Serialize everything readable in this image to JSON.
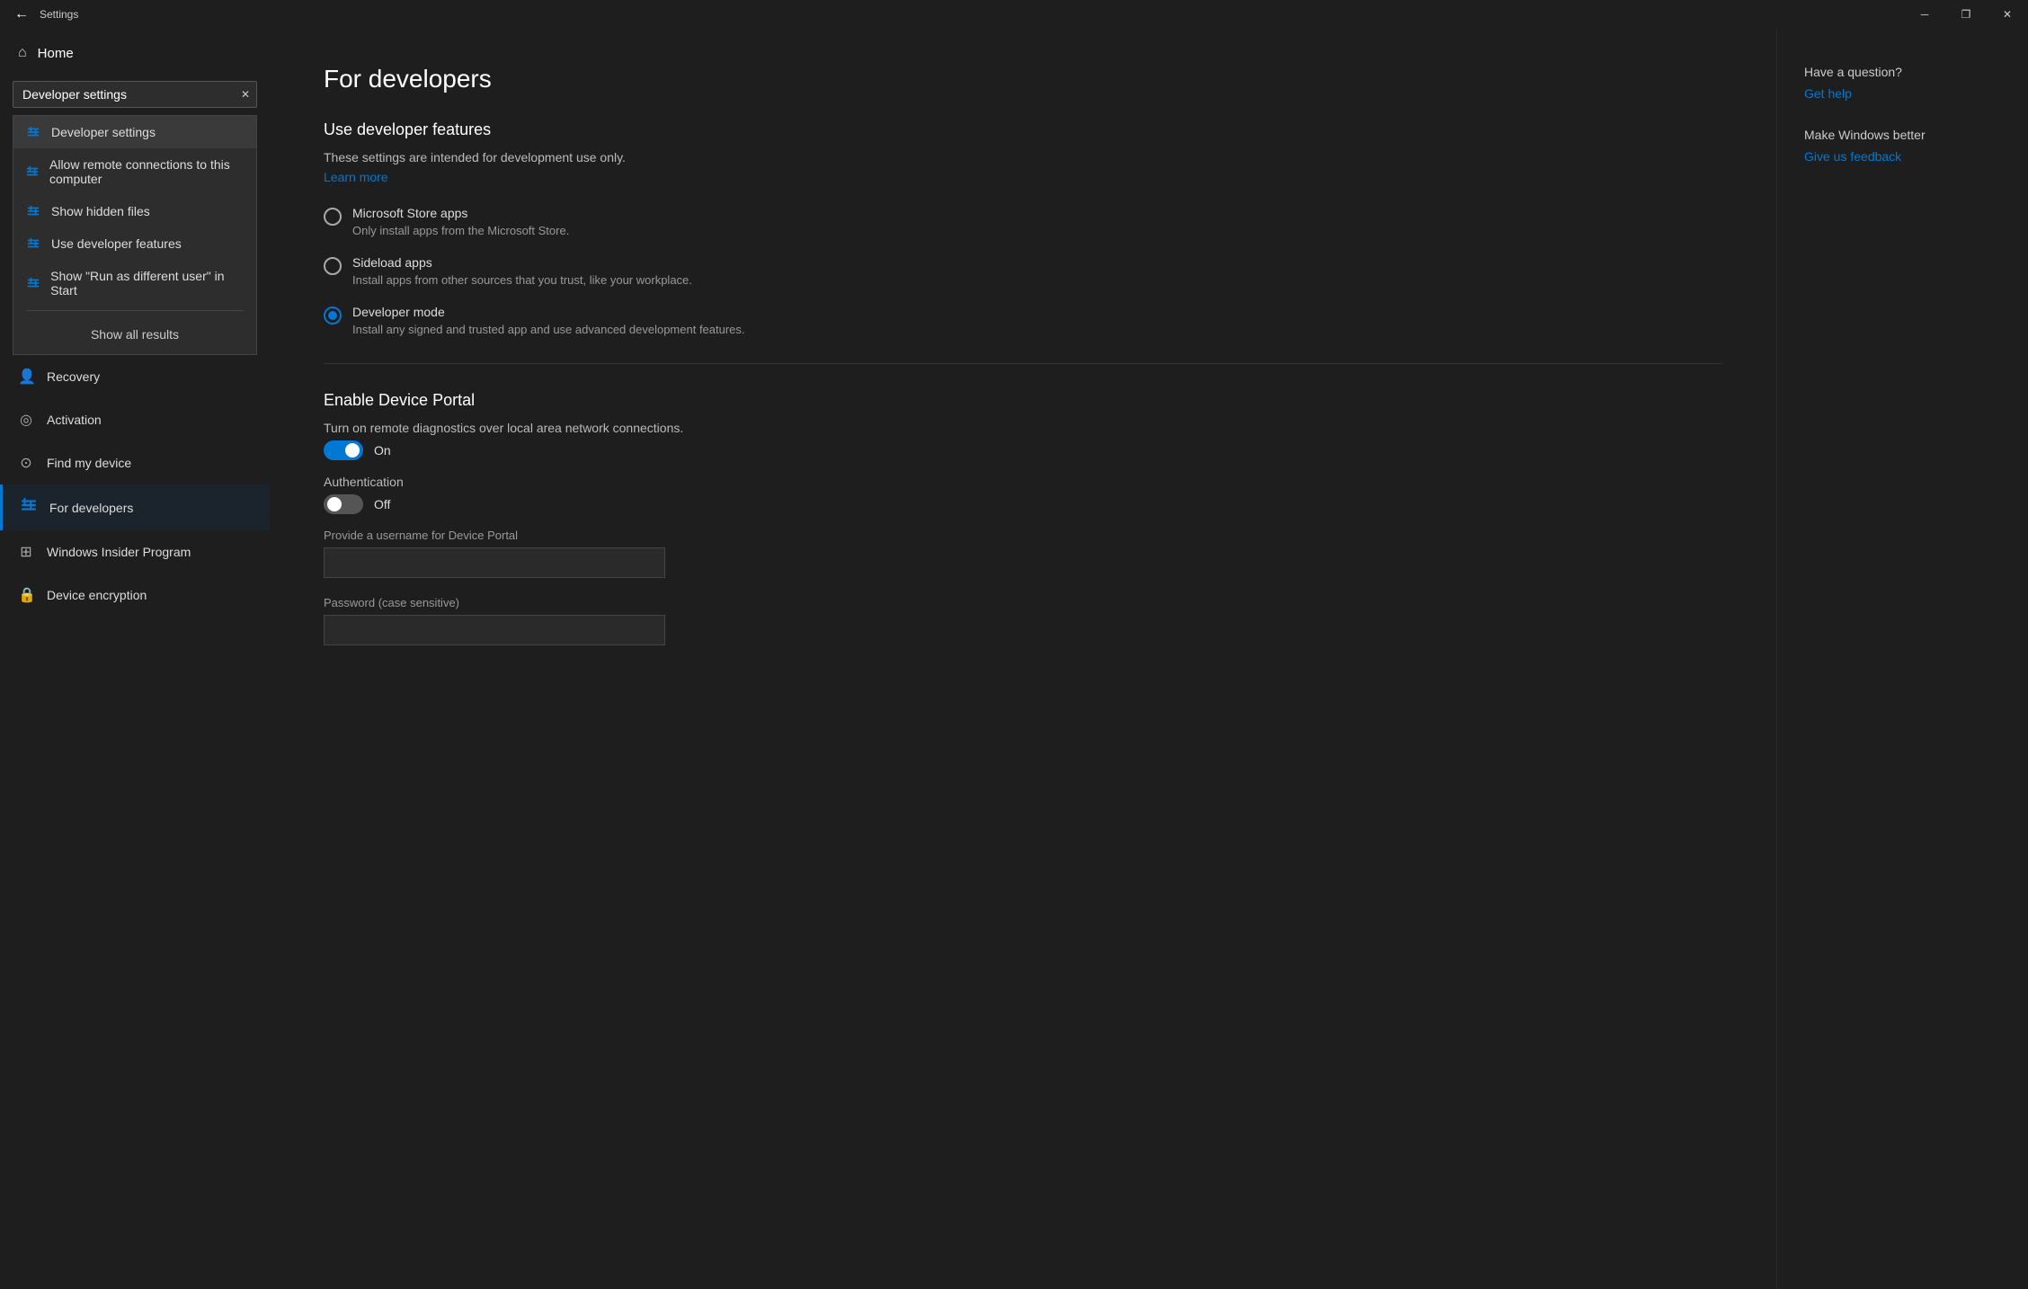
{
  "titleBar": {
    "title": "Settings",
    "minimizeLabel": "─",
    "restoreLabel": "❐",
    "closeLabel": "✕"
  },
  "sidebar": {
    "homeLabel": "Home",
    "searchPlaceholder": "Developer settings",
    "searchValue": "Developer settings",
    "dropdownItems": [
      {
        "id": "developer-settings",
        "label": "Developer settings",
        "active": true
      },
      {
        "id": "allow-remote",
        "label": "Allow remote connections to this computer",
        "active": false
      },
      {
        "id": "show-hidden",
        "label": "Show hidden files",
        "active": false
      },
      {
        "id": "use-developer",
        "label": "Use developer features",
        "active": false
      },
      {
        "id": "show-run-as",
        "label": "Show \"Run as different user\" in Start",
        "active": false
      }
    ],
    "showAllResults": "Show all results",
    "navItems": [
      {
        "id": "recovery",
        "label": "Recovery",
        "icon": "person"
      },
      {
        "id": "activation",
        "label": "Activation",
        "icon": "circle-check"
      },
      {
        "id": "find-my-device",
        "label": "Find my device",
        "icon": "person-circle"
      },
      {
        "id": "for-developers",
        "label": "For developers",
        "icon": "sliders",
        "active": true
      },
      {
        "id": "windows-insider",
        "label": "Windows Insider Program",
        "icon": "windows"
      },
      {
        "id": "device-encryption",
        "label": "Device encryption",
        "icon": "lock"
      }
    ]
  },
  "content": {
    "pageTitle": "For developers",
    "useDevFeatures": {
      "sectionTitle": "Use developer features",
      "description": "These settings are intended for development use only.",
      "learnMore": "Learn more",
      "radioOptions": [
        {
          "id": "microsoft-store",
          "label": "Microsoft Store apps",
          "sublabel": "Only install apps from the Microsoft Store.",
          "checked": false
        },
        {
          "id": "sideload",
          "label": "Sideload apps",
          "sublabel": "Install apps from other sources that you trust, like your workplace.",
          "checked": false
        },
        {
          "id": "developer-mode",
          "label": "Developer mode",
          "sublabel": "Install any signed and trusted app and use advanced development features.",
          "checked": true
        }
      ]
    },
    "devicePortal": {
      "sectionTitle": "Enable Device Portal",
      "description": "Turn on remote diagnostics over local area network connections.",
      "toggle": {
        "on": true,
        "labelOn": "On",
        "labelOff": "Off"
      },
      "authSection": {
        "label": "Authentication",
        "toggle": {
          "on": false,
          "labelOn": "On",
          "labelOff": "Off"
        }
      },
      "usernamePlaceholder": "Provide a username for Device Portal",
      "passwordPlaceholder": "Password (case sensitive)"
    }
  },
  "rightPanel": {
    "helpTitle": "Have a question?",
    "helpLink": "Get help",
    "feedbackTitle": "Make Windows better",
    "feedbackLink": "Give us feedback"
  }
}
